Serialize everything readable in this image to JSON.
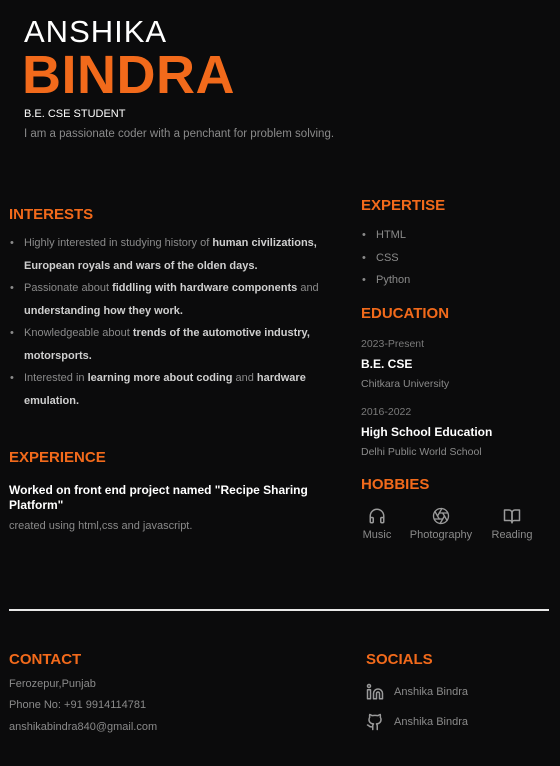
{
  "header": {
    "first_name": "ANSHIKA",
    "last_name": "BINDRA",
    "role": "B.E. CSE STUDENT",
    "tagline": "I am a passionate coder with a penchant for problem solving."
  },
  "interests": {
    "title": "INTERESTS",
    "items": [
      [
        "Highly interested in studying history of ",
        "human civilizations, European royals and wars of the olden days."
      ],
      [
        "Passionate about ",
        "fiddling with hardware components",
        " and ",
        "understanding how they work."
      ],
      [
        "Knowledgeable about ",
        "trends of the automotive industry, motorsports."
      ],
      [
        "Interested in ",
        "learning more about coding",
        " and ",
        "hardware emulation."
      ]
    ]
  },
  "experience": {
    "title": "EXPERIENCE",
    "project": "Worked on front end project named \"Recipe Sharing Platform\"",
    "description": "created using html,css and javascript."
  },
  "expertise": {
    "title": "EXPERTISE",
    "items": [
      "HTML",
      "CSS",
      "Python"
    ]
  },
  "education": {
    "title": "EDUCATION",
    "entries": [
      {
        "years": "2023-Present",
        "degree": "B.E. CSE",
        "school": "Chitkara University"
      },
      {
        "years": "2016-2022",
        "degree": "High School Education",
        "school": "Delhi Public World School"
      }
    ]
  },
  "hobbies": {
    "title": "HOBBIES",
    "items": [
      {
        "label": "Music",
        "icon": "headphones-icon"
      },
      {
        "label": "Photography",
        "icon": "camera-aperture-icon"
      },
      {
        "label": "Reading",
        "icon": "book-open-icon"
      }
    ]
  },
  "contact": {
    "title": "CONTACT",
    "location": "Ferozepur,Punjab",
    "phone": "Phone No: +91 9914114781",
    "email": "anshikabindra840@gmail.com"
  },
  "socials": {
    "title": "SOCIALS",
    "items": [
      {
        "label": "Anshika Bindra",
        "icon": "linkedin-icon"
      },
      {
        "label": "Anshika Bindra",
        "icon": "github-icon"
      }
    ]
  },
  "colors": {
    "accent": "#f26a1b",
    "background": "#0b0b0c",
    "text_muted": "#8a8a8a",
    "text_white": "#ffffff"
  }
}
